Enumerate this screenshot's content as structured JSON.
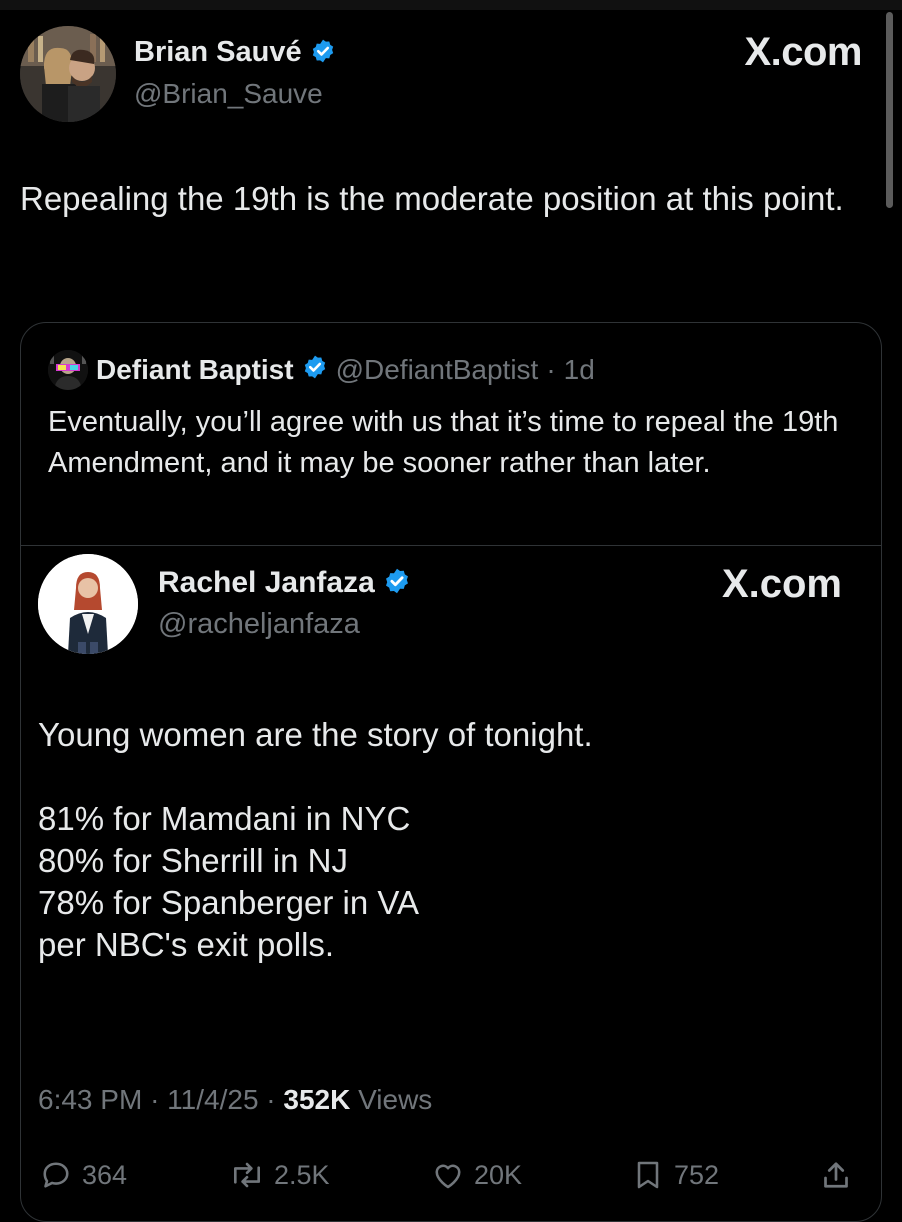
{
  "post": {
    "author": {
      "name": "Brian Sauvé",
      "handle": "@Brian_Sauve",
      "verified": true
    },
    "brand": "X.com",
    "text": "Repealing the 19th is the moderate position at this point."
  },
  "quote": {
    "name": "Defiant Baptist",
    "handle": "@DefiantBaptist",
    "separator": "·",
    "age": "1d",
    "text": "Eventually, you’ll agree with us that it’s time to repeal the 19th Amendment, and it may be sooner rather than later."
  },
  "embed": {
    "author": {
      "name": "Rachel Janfaza",
      "handle": "@racheljanfaza",
      "verified": true
    },
    "brand": "X.com",
    "lines": [
      "Young women are the story of tonight.",
      "",
      "81% for Mamdani in NYC",
      "80% for Sherrill in NJ",
      "78% for Spanberger in VA",
      "per NBC's exit polls."
    ],
    "meta": {
      "time": "6:43 PM",
      "date": "11/4/25",
      "separator": "·",
      "views_count": "352K",
      "views_label": "Views"
    },
    "actions": {
      "replies": "364",
      "reposts": "2.5K",
      "likes": "20K",
      "bookmarks": "752"
    }
  },
  "colors": {
    "background": "#000000",
    "text": "#e7e9ea",
    "muted": "#71767b",
    "border": "#2f3336",
    "verified": "#1d9bf0"
  },
  "icons": [
    "verified-badge-icon",
    "reply-icon",
    "repost-icon",
    "like-icon",
    "bookmark-icon",
    "share-icon"
  ]
}
